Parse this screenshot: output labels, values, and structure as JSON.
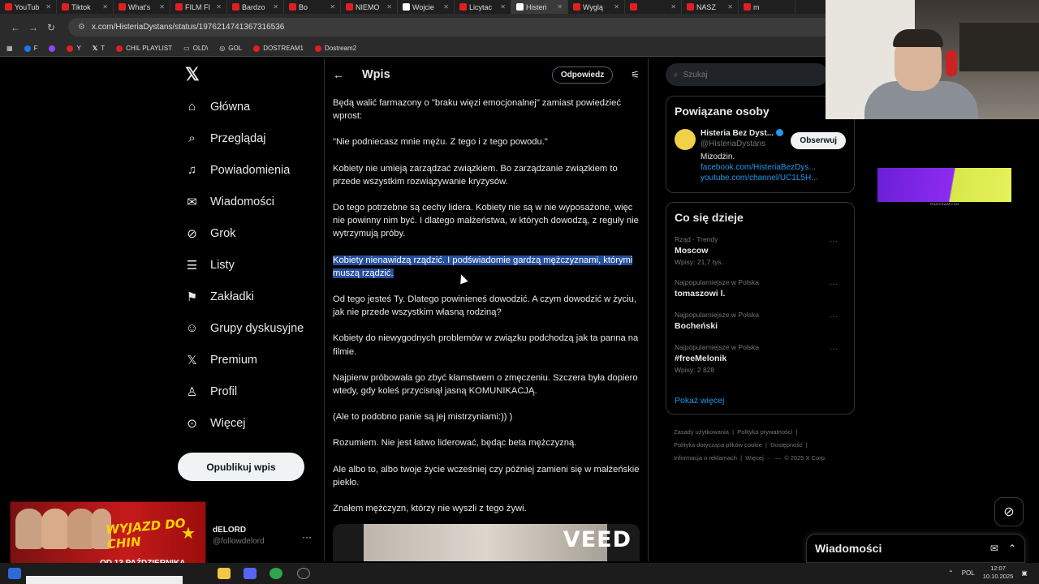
{
  "browser": {
    "tabs": [
      {
        "label": "YouTub"
      },
      {
        "label": "Tiktok"
      },
      {
        "label": "What's"
      },
      {
        "label": "FILM FI"
      },
      {
        "label": "Bardzo"
      },
      {
        "label": "Bo"
      },
      {
        "label": "NIEMO"
      },
      {
        "label": "Wojcie"
      },
      {
        "label": "Licytac"
      },
      {
        "label": "Histeri"
      },
      {
        "label": "Wyglą"
      },
      {
        "label": ""
      },
      {
        "label": "NASZ"
      },
      {
        "label": "m"
      }
    ],
    "url": "x.com/HisteriaDystans/status/1976214741367316536",
    "bookmarks": [
      {
        "label": "F"
      },
      {
        "label": "Y"
      },
      {
        "label": "T"
      },
      {
        "label": "CHIL PLAYLIST"
      },
      {
        "label": "OLD\\"
      },
      {
        "label": "GOL"
      },
      {
        "label": "DOSTREAM1"
      },
      {
        "label": "Dostream2"
      }
    ]
  },
  "sidebar": {
    "items": [
      {
        "label": "Główna",
        "icon": "home-icon"
      },
      {
        "label": "Przeglądaj",
        "icon": "search-icon"
      },
      {
        "label": "Powiadomienia",
        "icon": "bell-icon"
      },
      {
        "label": "Wiadomości",
        "icon": "mail-icon"
      },
      {
        "label": "Grok",
        "icon": "grok-icon"
      },
      {
        "label": "Listy",
        "icon": "list-icon"
      },
      {
        "label": "Zakładki",
        "icon": "bookmark-icon"
      },
      {
        "label": "Grupy dyskusyjne",
        "icon": "people-icon"
      },
      {
        "label": "Premium",
        "icon": "x-icon"
      },
      {
        "label": "Profil",
        "icon": "person-icon"
      },
      {
        "label": "Więcej",
        "icon": "more-icon"
      }
    ],
    "post_button": "Opublikuj wpis",
    "user": {
      "name": "dELORD",
      "handle": "@followdelord"
    }
  },
  "promo": {
    "title": "WYJAZD DO CHIN",
    "date": "OD 13 PAŹDZIERNIKA"
  },
  "main": {
    "title": "Wpis",
    "reply_button": "Odpowiedz",
    "paragraphs": [
      "Będą walić farmazony o \"braku więzi emocjonalnej\" zamiast powiedzieć wprost:",
      "\"Nie podniecasz mnie mężu. Z tego i z tego powodu.\"",
      "Kobiety nie umieją zarządzać związkiem. Bo zarządzanie związkiem to przede wszystkim rozwiązywanie kryzysów.",
      "Do tego potrzebne są cechy lidera. Kobiety nie są w nie wyposażone, więc nie powinny nim być. I dlatego małżeństwa, w których dowodzą, z reguły nie wytrzymują próby.",
      "Kobiety nienawidzą rządzić. I podświadomie gardzą mężczyznami, którymi muszą rządzić.",
      "Od tego jesteś Ty. Dlatego powinieneś dowodzić. A czym dowodzić w życiu, jak nie przede wszystkim własną rodziną?",
      "Kobiety do niewygodnych problemów w związku podchodzą jak ta panna na filmie.",
      "Najpierw próbowała go zbyć kłamstwem o zmęczeniu. Szczera była dopiero wtedy, gdy koleś przycisnął jasną KOMUNIKACJĄ.",
      "(Ale to podobno panie są jej mistrzyniami:)) )",
      "Rozumiem. Nie jest łatwo liderować, będąc beta mężczyzną.",
      "Ale albo to, albo twoje życie wcześniej czy później zamieni się w małżeńskie piekło.",
      "Znałem mężczyzn, którzy nie wyszli z tego żywi."
    ],
    "highlighted_index": 4,
    "media_watermark": "VEED"
  },
  "right": {
    "search_placeholder": "Szukaj",
    "people": {
      "title": "Powiązane osoby",
      "name": "Histeria Bez Dyst...",
      "handle": "@HisteriaDystans",
      "bio": "Mizodżin.",
      "link1": "facebook.com/HisteriaBezDys...",
      "link2": "youtube.com/channel/UC1L5H...",
      "follow": "Obserwuj"
    },
    "trends": {
      "title": "Co się dzieje",
      "items": [
        {
          "context": "Rząd · Trendy",
          "topic": "Moscow",
          "count": "Wpisy: 21,7 tys."
        },
        {
          "context": "Najpopularniejsze w Polska",
          "topic": "tomaszowi l.",
          "count": ""
        },
        {
          "context": "Najpopularniejsze w Polska",
          "topic": "Bocheński",
          "count": ""
        },
        {
          "context": "Najpopularniejsze w Polska",
          "topic": "#freeMelonik",
          "count": "Wpisy: 2 828"
        }
      ],
      "show_more": "Pokaż więcej"
    },
    "footer": [
      "Zasady użytkowania",
      "Polityka prywatności",
      "Polityka dotycząca plików cookie",
      "Dostępność",
      "Informacja o reklamach",
      "Więcej ···",
      "© 2025 X Corp."
    ],
    "banner_caption": "PIRATESWAP.COM"
  },
  "messages_drawer": {
    "title": "Wiadomości"
  },
  "taskbar": {
    "lang": "POL",
    "time": "12:07",
    "date": "10.10.2025"
  },
  "colors": {
    "accent": "#1d9bf0",
    "highlight": "#264f9e",
    "background": "#000000"
  }
}
